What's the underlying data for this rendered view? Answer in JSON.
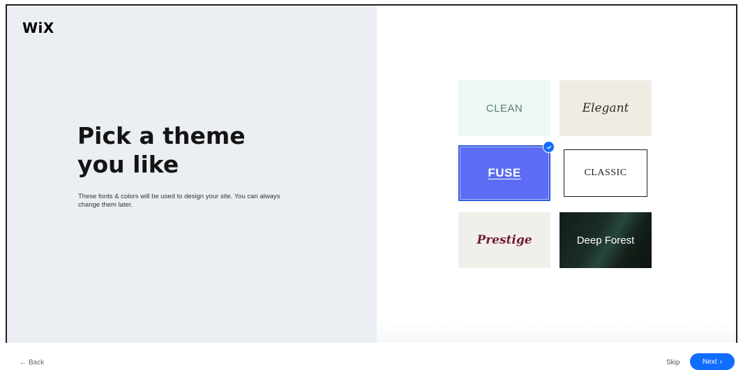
{
  "brand": {
    "logo": "WiX"
  },
  "intro": {
    "title_line1": "Pick a theme",
    "title_line2": "you like",
    "subtitle": "These fonts & colors will be used to design your site. You can always change them later."
  },
  "themes": [
    {
      "label": "CLEAN"
    },
    {
      "label": "Elegant"
    },
    {
      "label": "FUSE",
      "selected": true
    },
    {
      "label": "CLASSIC"
    },
    {
      "label": "Prestige"
    },
    {
      "label": "Deep Forest"
    }
  ],
  "footer": {
    "back_label": "Back",
    "skip_label": "Skip",
    "next_label": "Next"
  },
  "icons": {
    "back": "arrow-left-icon",
    "next": "chevron-right-icon",
    "selected": "check-icon"
  },
  "colors": {
    "accent": "#116dff",
    "left_panel_bg": "#ebeef2",
    "fuse_bg": "#5c6cf5",
    "prestige_text": "#6f1d33",
    "deep_forest_bg": "#1b2e26"
  }
}
